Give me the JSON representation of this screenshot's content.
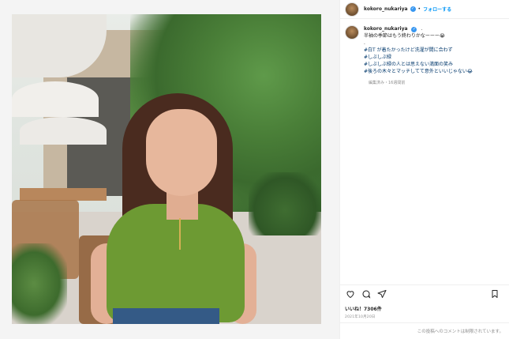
{
  "post": {
    "username": "kokoro_nukariya",
    "follow_label": "フォローする",
    "separator": "•",
    "caption": {
      "username": "kokoro_nukariya",
      "line1": "半袖の季節はもう終わりかなーーー😭",
      "line2": ".",
      "line3": "#白T が着たかったけど洗濯が間に合わず",
      "line4": "#しぶしぶ緑",
      "line5": "#しぶしぶ緑の人とは思えない満面の笑み",
      "line6": "#後ろの木々とマッチしてて意外といいじゃない😂"
    },
    "edited": "編集済み・16週間前",
    "likes": "いいね！7306件",
    "date": "2021年10月20日",
    "comments_off": "この投稿へのコメントは制限されています。"
  },
  "icons": {
    "verified": "verified-badge-icon",
    "more": "more-options-icon",
    "heart": "heart-icon",
    "comment": "comment-icon",
    "share": "share-icon",
    "bookmark": "bookmark-icon"
  },
  "colors": {
    "link_blue": "#0095f6",
    "hashtag_blue": "#00376b",
    "verified_blue": "#3897f0",
    "muted_gray": "#8e8e8e",
    "text": "#262626"
  }
}
